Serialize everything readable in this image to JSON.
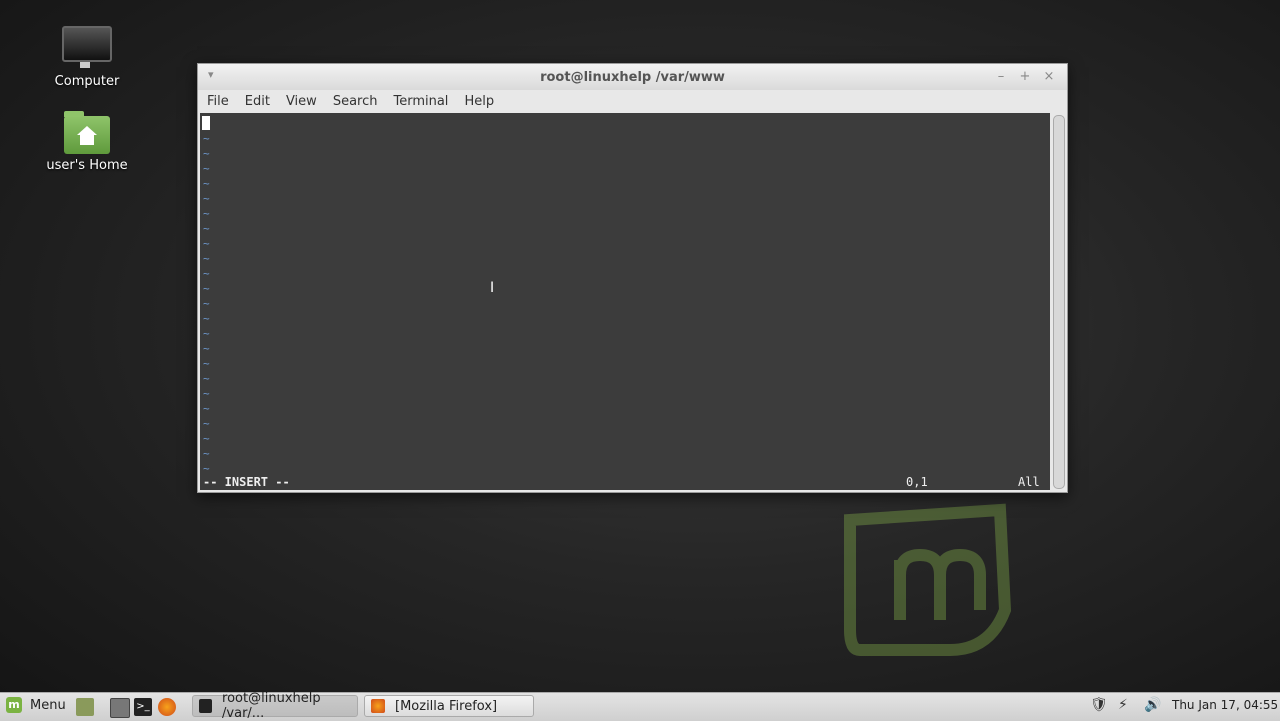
{
  "desktop": {
    "icons": [
      {
        "label": "Computer"
      },
      {
        "label": "user's Home"
      }
    ]
  },
  "window": {
    "title": "root@linuxhelp /var/www",
    "menu": [
      "File",
      "Edit",
      "View",
      "Search",
      "Terminal",
      "Help"
    ],
    "buttons": {
      "minimize": "–",
      "maximize": "+",
      "close": "×"
    },
    "editor": {
      "tilde_lines": 23,
      "mode": "-- INSERT --",
      "position": "0,1",
      "scroll": "All"
    }
  },
  "taskbar": {
    "menu_label": "Menu",
    "tasks": [
      {
        "label": "root@linuxhelp /var/..."
      },
      {
        "label": "[Mozilla Firefox]"
      }
    ],
    "clock": "Thu Jan 17, 04:55"
  },
  "colors": {
    "terminal_bg": "#3c3c3c",
    "tilde": "#6e9ad0",
    "mint_green": "#7bb342"
  }
}
